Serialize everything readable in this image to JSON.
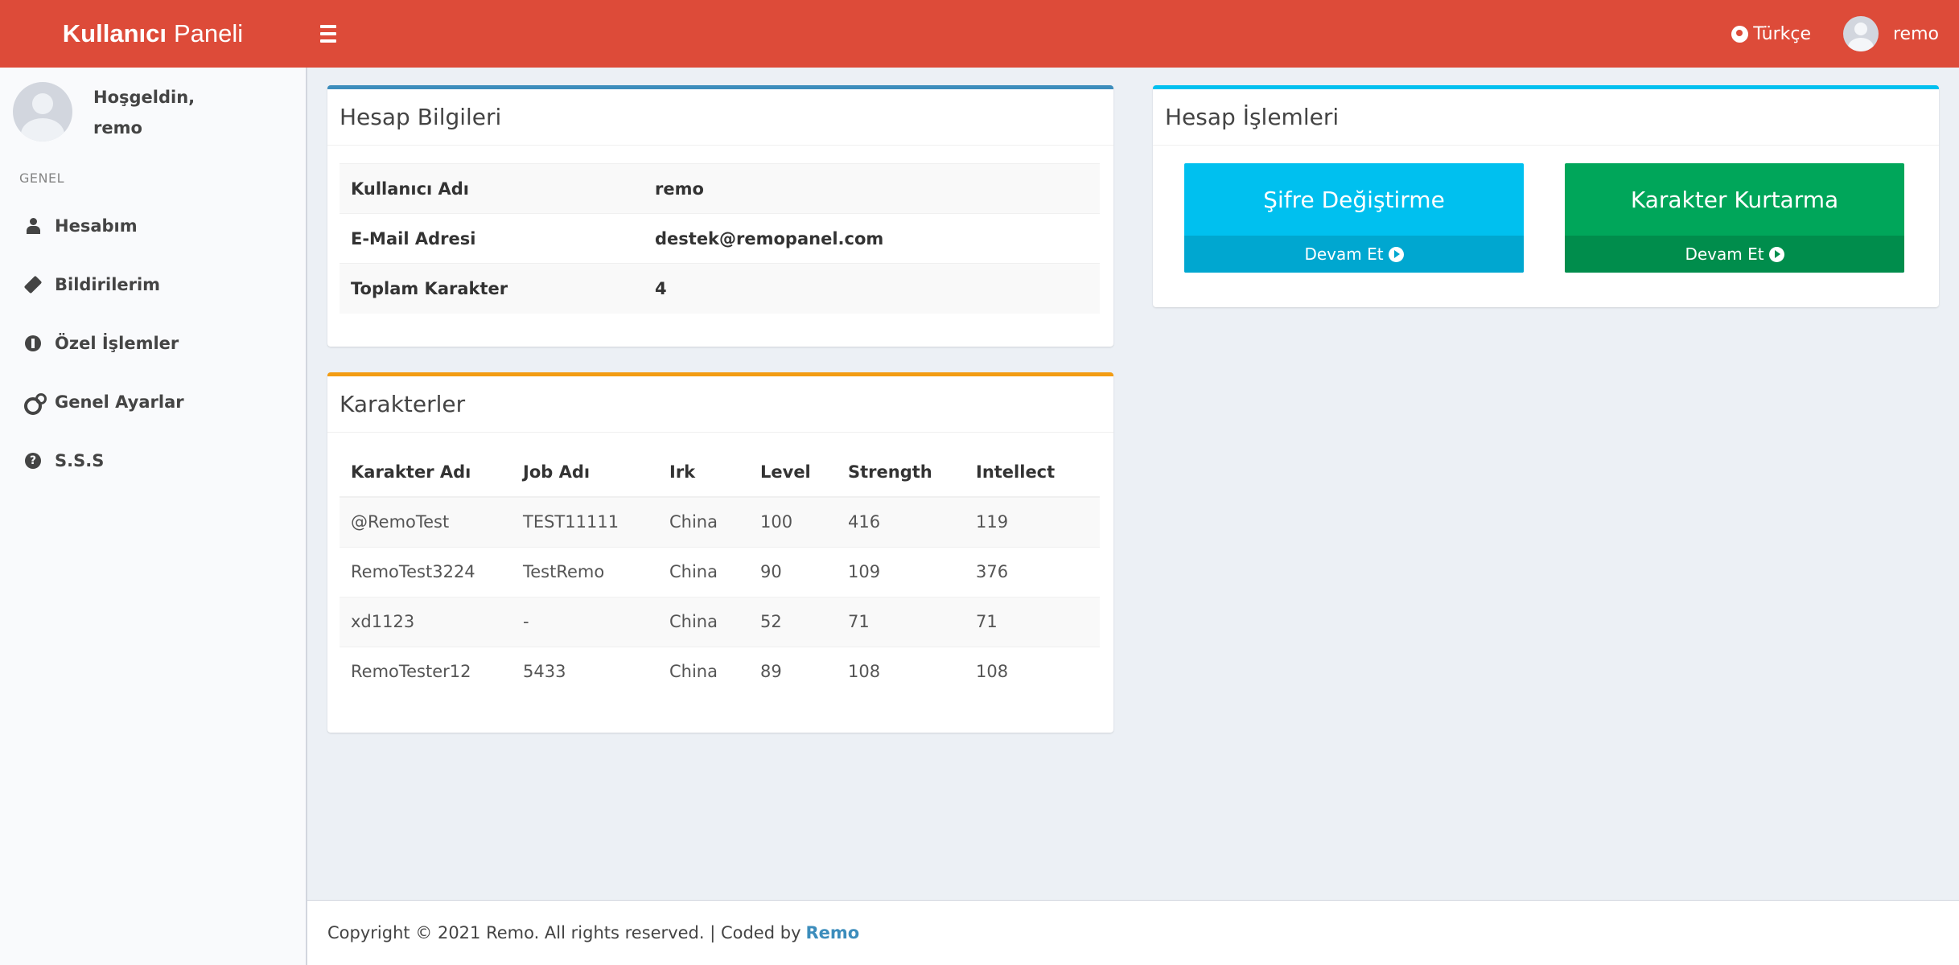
{
  "header": {
    "logo_bold": "Kullanıcı",
    "logo_light": "Paneli",
    "language": "Türkçe",
    "username": "remo"
  },
  "sidebar": {
    "greeting": "Hoşgeldin,",
    "username": "remo",
    "section_header": "GENEL",
    "items": [
      {
        "label": "Hesabım",
        "icon": "user-icon"
      },
      {
        "label": "Bildirilerim",
        "icon": "ticket-icon"
      },
      {
        "label": "Özel İşlemler",
        "icon": "info-circle-icon"
      },
      {
        "label": "Genel Ayarlar",
        "icon": "gears-icon"
      },
      {
        "label": "S.S.S",
        "icon": "question-circle-icon"
      }
    ]
  },
  "account_info": {
    "title": "Hesap Bilgileri",
    "rows": [
      {
        "label": "Kullanıcı Adı",
        "value": "remo"
      },
      {
        "label": "E-Mail Adresi",
        "value": "destek@remopanel.com"
      },
      {
        "label": "Toplam Karakter",
        "value": "4"
      }
    ]
  },
  "characters": {
    "title": "Karakterler",
    "columns": [
      "Karakter Adı",
      "Job Adı",
      "Irk",
      "Level",
      "Strength",
      "Intellect"
    ],
    "rows": [
      [
        "@RemoTest",
        "TEST11111",
        "China",
        "100",
        "416",
        "119"
      ],
      [
        "RemoTest3224",
        "TestRemo",
        "China",
        "90",
        "109",
        "376"
      ],
      [
        "xd1123",
        "-",
        "China",
        "52",
        "71",
        "71"
      ],
      [
        "RemoTester12",
        "5433",
        "China",
        "89",
        "108",
        "108"
      ]
    ]
  },
  "account_actions": {
    "title": "Hesap İşlemleri",
    "tiles": [
      {
        "label": "Şifre Değiştirme",
        "footer": "Devam Et",
        "color": "#00c0ef"
      },
      {
        "label": "Karakter Kurtarma",
        "footer": "Devam Et",
        "color": "#00a65a"
      }
    ]
  },
  "footer": {
    "text": "Copyright © 2021 Remo. All rights reserved. | Coded by",
    "link": "Remo"
  },
  "colors": {
    "header": "#dd4b39",
    "box_primary": "#3c8dbc",
    "box_warning": "#f39c12",
    "box_info": "#00c0ef"
  }
}
